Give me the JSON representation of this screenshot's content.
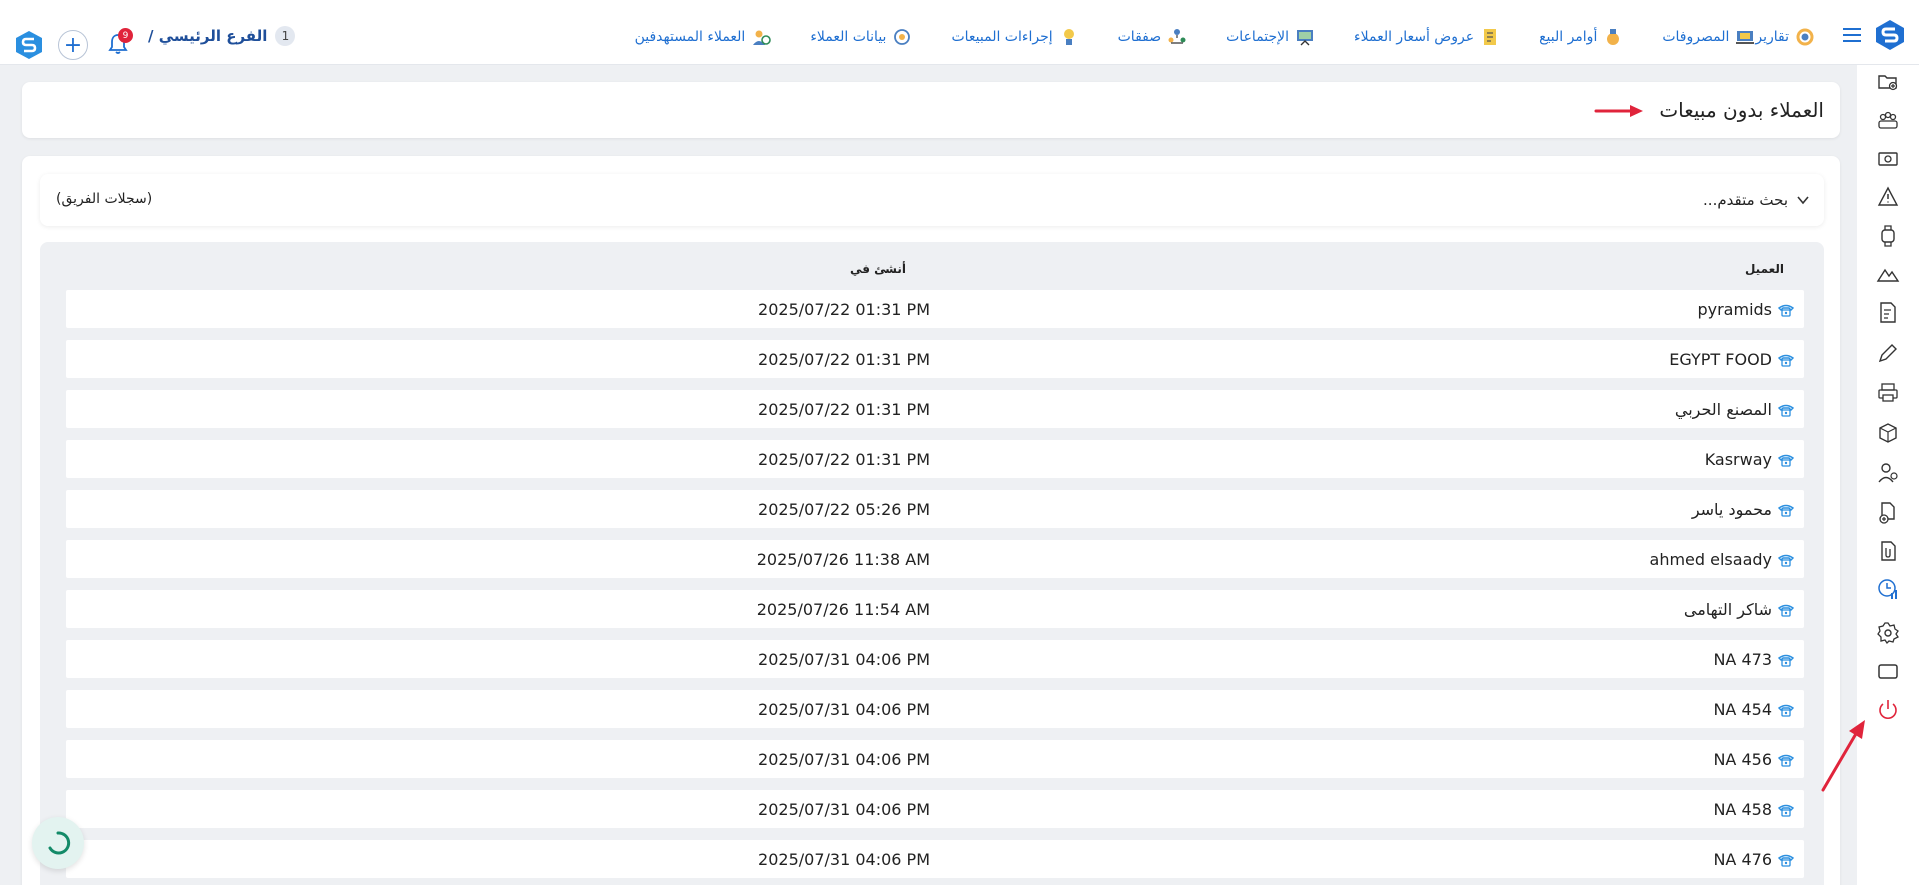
{
  "topbar": {
    "nav_items": [
      {
        "label": "العملاء المستهدفين",
        "icon": "target-clients-icon"
      },
      {
        "label": "بيانات العملاء",
        "icon": "client-data-icon"
      },
      {
        "label": "إجراءات المبيعات",
        "icon": "sales-actions-icon"
      },
      {
        "label": "صفقات",
        "icon": "deals-icon"
      },
      {
        "label": "الإجتماعات",
        "icon": "meetings-icon"
      },
      {
        "label": "عروض أسعار العملاء",
        "icon": "quotes-icon"
      },
      {
        "label": "أوامر البيع",
        "icon": "sales-orders-icon"
      },
      {
        "label": "المصروفات",
        "icon": "expenses-icon"
      },
      {
        "label": "تقارير",
        "icon": "reports-icon"
      }
    ],
    "branch_number": "1",
    "branch_name": "الفرع الرئيسي /",
    "notification_count": "9",
    "plus_symbol": "+"
  },
  "page": {
    "title": "العملاء بدون مبيعات"
  },
  "search": {
    "label": "بحث متقدم...",
    "team_records": "(سجلات الفريق)"
  },
  "table": {
    "columns": {
      "client": "العميل",
      "created_at": "أنشئ في"
    },
    "rows": [
      {
        "client": "pyramids",
        "created_at": "2025/07/22 01:31 PM"
      },
      {
        "client": "EGYPT FOOD",
        "created_at": "2025/07/22 01:31 PM"
      },
      {
        "client": "المصنع الحربي",
        "created_at": "2025/07/22 01:31 PM"
      },
      {
        "client": "Kasrway",
        "created_at": "2025/07/22 01:31 PM"
      },
      {
        "client": "محمود ياسر",
        "created_at": "2025/07/22 05:26 PM"
      },
      {
        "client": "ahmed elsaady",
        "created_at": "2025/07/26 11:38 AM"
      },
      {
        "client": "شاكر التهامى",
        "created_at": "2025/07/26 11:54 AM"
      },
      {
        "client": "NA 473",
        "created_at": "2025/07/31 04:06 PM"
      },
      {
        "client": "NA 454",
        "created_at": "2025/07/31 04:06 PM"
      },
      {
        "client": "NA 456",
        "created_at": "2025/07/31 04:06 PM"
      },
      {
        "client": "NA 458",
        "created_at": "2025/07/31 04:06 PM"
      },
      {
        "client": "NA 476",
        "created_at": "2025/07/31 04:06 PM"
      }
    ]
  },
  "sidebar": {
    "icons": [
      "folder-add-icon",
      "team-icon",
      "cash-icon",
      "warning-icon",
      "smartwatch-icon",
      "mountain-icon",
      "invoice-icon",
      "pen-icon",
      "printer-icon",
      "package-icon",
      "user-money-icon",
      "add-document-icon",
      "attachment-icon",
      "chart-clock-icon",
      "settings-icon",
      "monitor-icon",
      "power-icon"
    ],
    "active_icon": "chart-clock-icon"
  },
  "colors": {
    "accent": "#1f6fd1",
    "annotation_arrow": "#e0243b",
    "background": "#eef0f3",
    "badge": "#e0243b"
  }
}
